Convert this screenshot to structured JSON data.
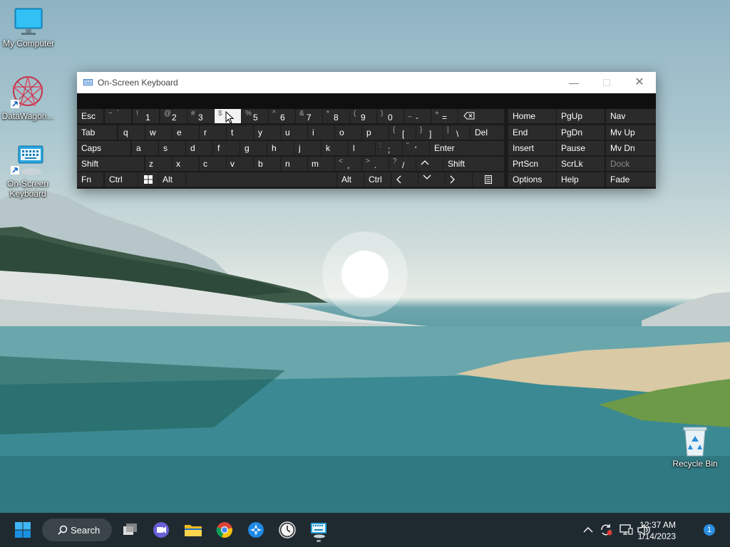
{
  "desktop": {
    "icons": [
      {
        "label": "My Computer"
      },
      {
        "label": "DataWagon..."
      },
      {
        "label": "On-Screen Keyboard"
      },
      {
        "label": "Recycle Bin"
      }
    ]
  },
  "osk": {
    "title": "On-Screen Keyboard",
    "rows": {
      "r1": [
        "Esc",
        "~",
        "`",
        "!",
        "1",
        "@",
        "2",
        "#",
        "3",
        "$",
        "4",
        "%",
        "5",
        "^",
        "6",
        "&",
        "7",
        "*",
        "8",
        "(",
        "9",
        ")",
        "0",
        "_",
        "-",
        "+",
        "="
      ],
      "r2": [
        "Tab",
        "q",
        "w",
        "e",
        "r",
        "t",
        "y",
        "u",
        "i",
        "o",
        "p",
        "{",
        "[",
        "}",
        "]",
        "|",
        "\\",
        "Del"
      ],
      "r3": [
        "Caps",
        "a",
        "s",
        "d",
        "f",
        "g",
        "h",
        "j",
        "k",
        "l",
        ":",
        ";",
        "\"",
        "'",
        "Enter"
      ],
      "r4": [
        "Shift",
        "z",
        "x",
        "c",
        "v",
        "b",
        "n",
        "m",
        "<",
        ",",
        ">",
        ".",
        "?",
        "/",
        "Shift"
      ],
      "r5": [
        "Fn",
        "Ctrl",
        "Alt",
        "Alt",
        "Ctrl"
      ]
    },
    "nav": {
      "home": "Home",
      "pgup": "PgUp",
      "nav": "Nav",
      "end": "End",
      "pgdn": "PgDn",
      "mvup": "Mv Up",
      "insert": "Insert",
      "pause": "Pause",
      "mvdn": "Mv Dn",
      "prtscn": "PrtScn",
      "scrlk": "ScrLk",
      "dock": "Dock",
      "options": "Options",
      "help": "Help",
      "fade": "Fade"
    },
    "highlighted_key": "4"
  },
  "taskbar": {
    "search_label": "Search",
    "time": "12:37 AM",
    "date": "1/14/2023",
    "notification_count": "1"
  },
  "colors": {
    "key_bg": "#2b2b2b",
    "osk_bg": "#1b1b1b",
    "highlight": "#f2f2f2",
    "taskbar": "#1f2a30"
  }
}
